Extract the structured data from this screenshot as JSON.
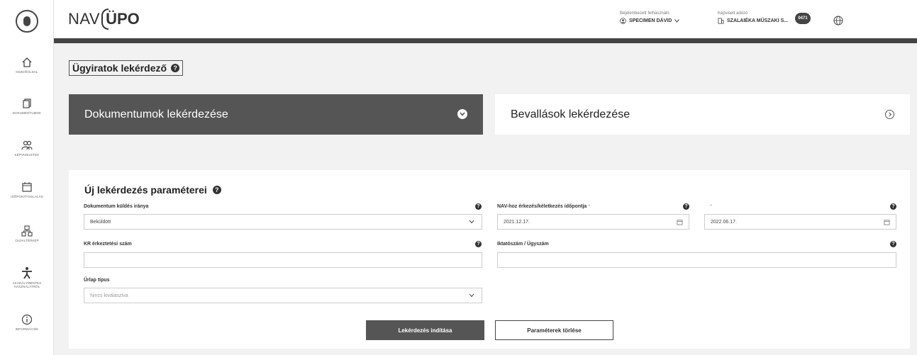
{
  "header": {
    "brand_left": "NAV",
    "brand_right": "ÜPO",
    "user_caption": "Bejelentkezett felhasználó",
    "user_name": "SPECIMEN DÁVID",
    "rep_caption": "Képviselt adózó",
    "rep_name": "SZALAIÉKA MŰSZAKI S...",
    "chat_badge": "0471"
  },
  "sidebar": {
    "items": [
      {
        "label": "KEZDŐOLDAL",
        "icon": "home-icon"
      },
      {
        "label": "DOKUMENTUMOK",
        "icon": "documents-icon"
      },
      {
        "label": "KÉPVISELETEK",
        "icon": "people-icon"
      },
      {
        "label": "IDŐPONTFOGLALÁS",
        "icon": "calendar-icon"
      },
      {
        "label": "OLDALTÉRKÉP",
        "icon": "sitemap-icon"
      },
      {
        "label": "AKADÁLYMENTES HASZNÁLATRÓL",
        "icon": "accessibility-icon"
      },
      {
        "label": "INFORMÁCIÓK",
        "icon": "info-icon"
      }
    ]
  },
  "page": {
    "title": "Ügyiratok lekérdező",
    "tab_active": "Dokumentumok lekérdezése",
    "tab_inactive": "Bevallások lekérdezése"
  },
  "form": {
    "title": "Új lekérdezés paraméterei",
    "direction_label": "Dokumentum küldés iránya",
    "direction_value": "Beküldött",
    "date_label": "NAV-hoz érkezés/kéletkezés időpontja",
    "date_required": "*",
    "date_to_label": "*",
    "date_from": "2021.12.17.",
    "date_to": "2022.06.17.",
    "kr_label": "KR érkeztetési szám",
    "kr_value": "",
    "iktato_label": "Iktatószám / Ügyszám",
    "iktato_value": "",
    "form_type_label": "Űrlap típus",
    "form_type_placeholder": "Nincs kiválasztva",
    "submit_label": "Lekérdezés indítása",
    "clear_label": "Paraméterek törlése"
  },
  "colors": {
    "dark": "#555555",
    "header_bar": "#444444"
  }
}
